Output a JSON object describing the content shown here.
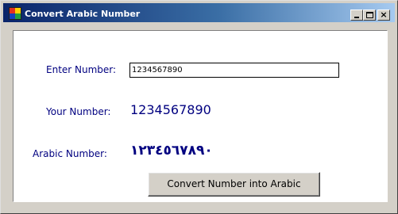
{
  "window": {
    "title": "Convert Arabic Number",
    "icon": "app-icon",
    "controls": {
      "minimize_icon": "minimize-icon",
      "maximize_icon": "maximize-icon",
      "close_label": "×"
    }
  },
  "form": {
    "enter_label": "Enter Number:",
    "input_value": "1234567890",
    "your_label": "Your Number:",
    "your_value": "1234567890",
    "arabic_label": "Arabic Number:",
    "arabic_value": "١٢٣٤٥٦٧٨٩٠",
    "convert_button_label": "Convert Number into Arabic"
  },
  "colors": {
    "title_gradient_start": "#0a246a",
    "title_gradient_end": "#a6caf0",
    "label_color": "#000080",
    "window_face": "#d4d0c8"
  }
}
